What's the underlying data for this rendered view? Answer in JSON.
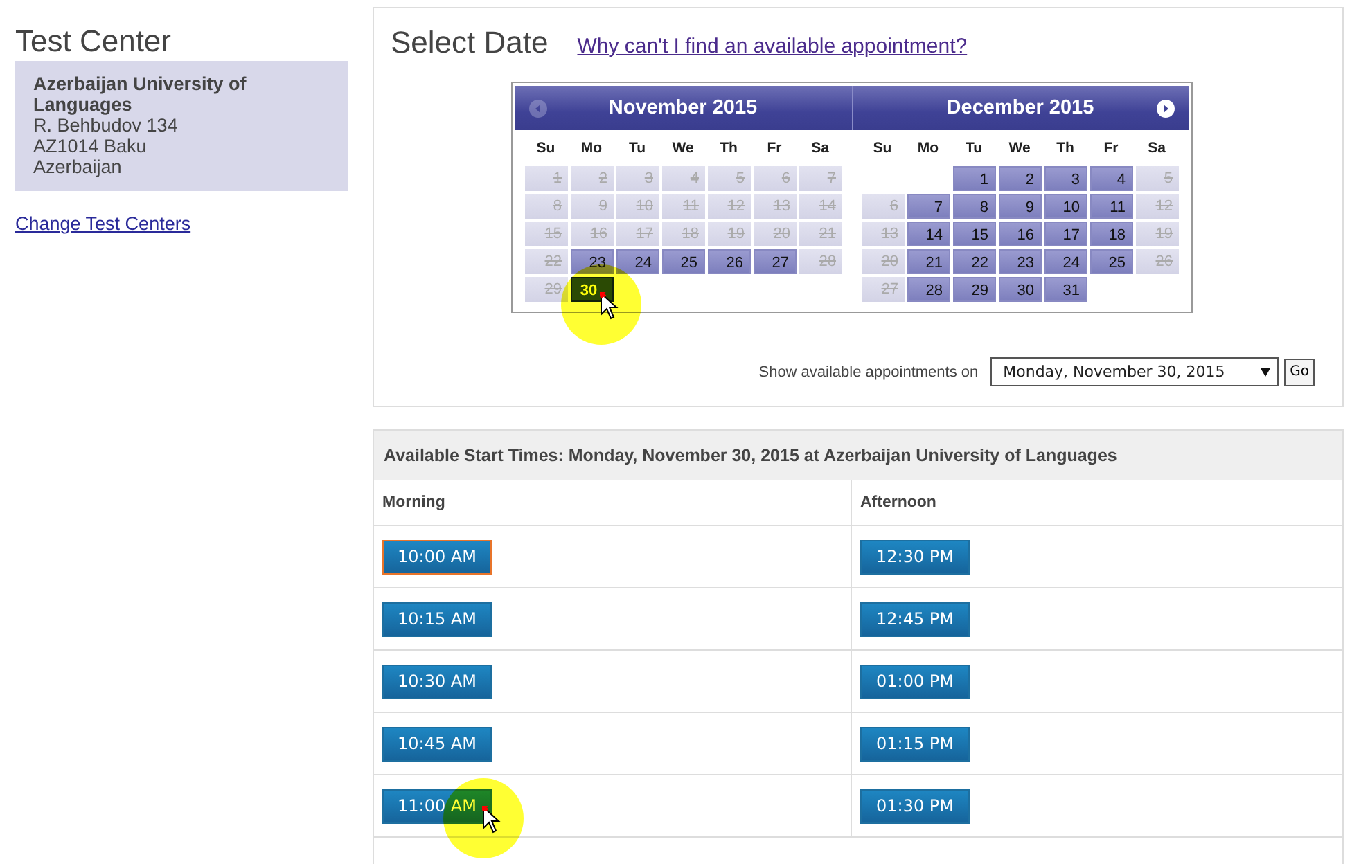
{
  "test_center": {
    "heading": "Test Center",
    "name": "Azerbaijan University of Languages",
    "address": [
      "R. Behbudov 134",
      "AZ1014 Baku",
      "Azerbaijan"
    ],
    "change_link": "Change Test Centers"
  },
  "select_date": {
    "heading": "Select Date",
    "help_link": "Why can't I find an available appointment?",
    "calendar": {
      "prev_disabled": true,
      "next_disabled": false,
      "months": [
        {
          "title": "November 2015",
          "weekdays": [
            "Su",
            "Mo",
            "Tu",
            "We",
            "Th",
            "Fr",
            "Sa"
          ],
          "weeks": [
            [
              {
                "kind": "day",
                "day": "1",
                "available": false,
                "selected": false,
                "pointer": false
              },
              {
                "kind": "day",
                "day": "2",
                "available": false,
                "selected": false,
                "pointer": false
              },
              {
                "kind": "day",
                "day": "3",
                "available": false,
                "selected": false,
                "pointer": false
              },
              {
                "kind": "day",
                "day": "4",
                "available": false,
                "selected": false,
                "pointer": false
              },
              {
                "kind": "day",
                "day": "5",
                "available": false,
                "selected": false,
                "pointer": false
              },
              {
                "kind": "day",
                "day": "6",
                "available": false,
                "selected": false,
                "pointer": false
              },
              {
                "kind": "day",
                "day": "7",
                "available": false,
                "selected": false,
                "pointer": false
              }
            ],
            [
              {
                "kind": "day",
                "day": "8",
                "available": false,
                "selected": false,
                "pointer": false
              },
              {
                "kind": "day",
                "day": "9",
                "available": false,
                "selected": false,
                "pointer": false
              },
              {
                "kind": "day",
                "day": "10",
                "available": false,
                "selected": false,
                "pointer": false
              },
              {
                "kind": "day",
                "day": "11",
                "available": false,
                "selected": false,
                "pointer": false
              },
              {
                "kind": "day",
                "day": "12",
                "available": false,
                "selected": false,
                "pointer": false
              },
              {
                "kind": "day",
                "day": "13",
                "available": false,
                "selected": false,
                "pointer": false
              },
              {
                "kind": "day",
                "day": "14",
                "available": false,
                "selected": false,
                "pointer": false
              }
            ],
            [
              {
                "kind": "day",
                "day": "15",
                "available": false,
                "selected": false,
                "pointer": false
              },
              {
                "kind": "day",
                "day": "16",
                "available": false,
                "selected": false,
                "pointer": false
              },
              {
                "kind": "day",
                "day": "17",
                "available": false,
                "selected": false,
                "pointer": false
              },
              {
                "kind": "day",
                "day": "18",
                "available": false,
                "selected": false,
                "pointer": false
              },
              {
                "kind": "day",
                "day": "19",
                "available": false,
                "selected": false,
                "pointer": false
              },
              {
                "kind": "day",
                "day": "20",
                "available": false,
                "selected": false,
                "pointer": false
              },
              {
                "kind": "day",
                "day": "21",
                "available": false,
                "selected": false,
                "pointer": false
              }
            ],
            [
              {
                "kind": "day",
                "day": "22",
                "available": false,
                "selected": false,
                "pointer": false
              },
              {
                "kind": "day",
                "day": "23",
                "available": true,
                "selected": false,
                "pointer": false
              },
              {
                "kind": "day",
                "day": "24",
                "available": true,
                "selected": false,
                "pointer": false
              },
              {
                "kind": "day",
                "day": "25",
                "available": true,
                "selected": false,
                "pointer": false
              },
              {
                "kind": "day",
                "day": "26",
                "available": true,
                "selected": false,
                "pointer": false
              },
              {
                "kind": "day",
                "day": "27",
                "available": true,
                "selected": false,
                "pointer": false
              },
              {
                "kind": "day",
                "day": "28",
                "available": false,
                "selected": false,
                "pointer": false
              }
            ],
            [
              {
                "kind": "day",
                "day": "29",
                "available": false,
                "selected": false,
                "pointer": false
              },
              {
                "kind": "day",
                "day": "30",
                "available": true,
                "selected": true,
                "pointer": true
              },
              {
                "kind": "blank"
              },
              {
                "kind": "blank"
              },
              {
                "kind": "blank"
              },
              {
                "kind": "blank"
              },
              {
                "kind": "blank"
              }
            ]
          ]
        },
        {
          "title": "December 2015",
          "weekdays": [
            "Su",
            "Mo",
            "Tu",
            "We",
            "Th",
            "Fr",
            "Sa"
          ],
          "weeks": [
            [
              {
                "kind": "blank"
              },
              {
                "kind": "blank"
              },
              {
                "kind": "day",
                "day": "1",
                "available": true,
                "selected": false,
                "pointer": false
              },
              {
                "kind": "day",
                "day": "2",
                "available": true,
                "selected": false,
                "pointer": false
              },
              {
                "kind": "day",
                "day": "3",
                "available": true,
                "selected": false,
                "pointer": false
              },
              {
                "kind": "day",
                "day": "4",
                "available": true,
                "selected": false,
                "pointer": false
              },
              {
                "kind": "day",
                "day": "5",
                "available": false,
                "selected": false,
                "pointer": false
              }
            ],
            [
              {
                "kind": "day",
                "day": "6",
                "available": false,
                "selected": false,
                "pointer": false
              },
              {
                "kind": "day",
                "day": "7",
                "available": true,
                "selected": false,
                "pointer": false
              },
              {
                "kind": "day",
                "day": "8",
                "available": true,
                "selected": false,
                "pointer": false
              },
              {
                "kind": "day",
                "day": "9",
                "available": true,
                "selected": false,
                "pointer": false
              },
              {
                "kind": "day",
                "day": "10",
                "available": true,
                "selected": false,
                "pointer": false
              },
              {
                "kind": "day",
                "day": "11",
                "available": true,
                "selected": false,
                "pointer": false
              },
              {
                "kind": "day",
                "day": "12",
                "available": false,
                "selected": false,
                "pointer": false
              }
            ],
            [
              {
                "kind": "day",
                "day": "13",
                "available": false,
                "selected": false,
                "pointer": false
              },
              {
                "kind": "day",
                "day": "14",
                "available": true,
                "selected": false,
                "pointer": false
              },
              {
                "kind": "day",
                "day": "15",
                "available": true,
                "selected": false,
                "pointer": false
              },
              {
                "kind": "day",
                "day": "16",
                "available": true,
                "selected": false,
                "pointer": false
              },
              {
                "kind": "day",
                "day": "17",
                "available": true,
                "selected": false,
                "pointer": false
              },
              {
                "kind": "day",
                "day": "18",
                "available": true,
                "selected": false,
                "pointer": false
              },
              {
                "kind": "day",
                "day": "19",
                "available": false,
                "selected": false,
                "pointer": false
              }
            ],
            [
              {
                "kind": "day",
                "day": "20",
                "available": false,
                "selected": false,
                "pointer": false
              },
              {
                "kind": "day",
                "day": "21",
                "available": true,
                "selected": false,
                "pointer": false
              },
              {
                "kind": "day",
                "day": "22",
                "available": true,
                "selected": false,
                "pointer": false
              },
              {
                "kind": "day",
                "day": "23",
                "available": true,
                "selected": false,
                "pointer": false
              },
              {
                "kind": "day",
                "day": "24",
                "available": true,
                "selected": false,
                "pointer": false
              },
              {
                "kind": "day",
                "day": "25",
                "available": true,
                "selected": false,
                "pointer": false
              },
              {
                "kind": "day",
                "day": "26",
                "available": false,
                "selected": false,
                "pointer": false
              }
            ],
            [
              {
                "kind": "day",
                "day": "27",
                "available": false,
                "selected": false,
                "pointer": false
              },
              {
                "kind": "day",
                "day": "28",
                "available": true,
                "selected": false,
                "pointer": false
              },
              {
                "kind": "day",
                "day": "29",
                "available": true,
                "selected": false,
                "pointer": false
              },
              {
                "kind": "day",
                "day": "30",
                "available": true,
                "selected": false,
                "pointer": false
              },
              {
                "kind": "day",
                "day": "31",
                "available": true,
                "selected": false,
                "pointer": false
              },
              {
                "kind": "blank"
              },
              {
                "kind": "blank"
              }
            ]
          ]
        }
      ]
    },
    "show_label": "Show available appointments on",
    "date_select": "Monday, November 30, 2015",
    "go_button": "Go"
  },
  "start_times": {
    "title": "Available Start Times: Monday, November 30, 2015 at Azerbaijan University of Languages",
    "columns": [
      {
        "heading": "Morning",
        "slots": [
          {
            "time": "10:00 AM",
            "focused": true,
            "pointer": false
          },
          {
            "time": "10:15 AM",
            "focused": false,
            "pointer": false
          },
          {
            "time": "10:30 AM",
            "focused": false,
            "pointer": false
          },
          {
            "time": "10:45 AM",
            "focused": false,
            "pointer": false
          },
          {
            "time": "11:00 AM",
            "focused": false,
            "pointer": true
          }
        ]
      },
      {
        "heading": "Afternoon",
        "slots": [
          {
            "time": "12:30 PM",
            "focused": false,
            "pointer": false
          },
          {
            "time": "12:45 PM",
            "focused": false,
            "pointer": false
          },
          {
            "time": "01:00 PM",
            "focused": false,
            "pointer": false
          },
          {
            "time": "01:15 PM",
            "focused": false,
            "pointer": false
          },
          {
            "time": "01:30 PM",
            "focused": false,
            "pointer": false
          }
        ]
      }
    ]
  }
}
